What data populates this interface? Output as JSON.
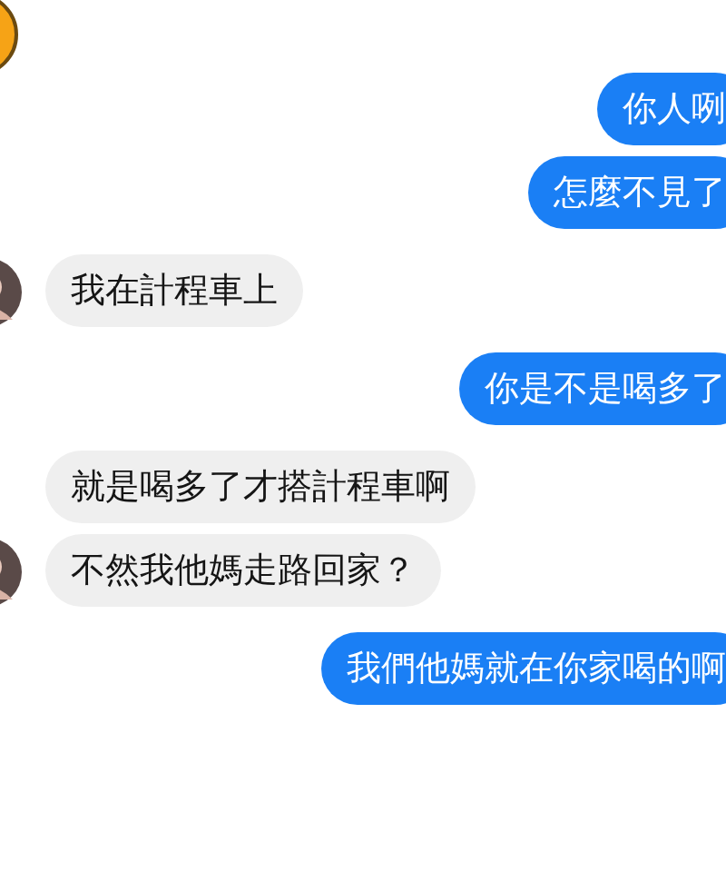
{
  "messages": [
    {
      "kind": "sent",
      "text": "你人咧"
    },
    {
      "kind": "sent",
      "text": "怎麼不見了"
    },
    {
      "kind": "received",
      "text": "我在計程車上",
      "avatar": true
    },
    {
      "kind": "sent",
      "text": "你是不是喝多了"
    },
    {
      "kind": "received",
      "text": "就是喝多了才搭計程車啊",
      "avatar": false
    },
    {
      "kind": "received",
      "text": "不然我他媽走路回家？",
      "avatar": true
    },
    {
      "kind": "sent",
      "text": "我們他媽就在你家喝的啊"
    }
  ]
}
